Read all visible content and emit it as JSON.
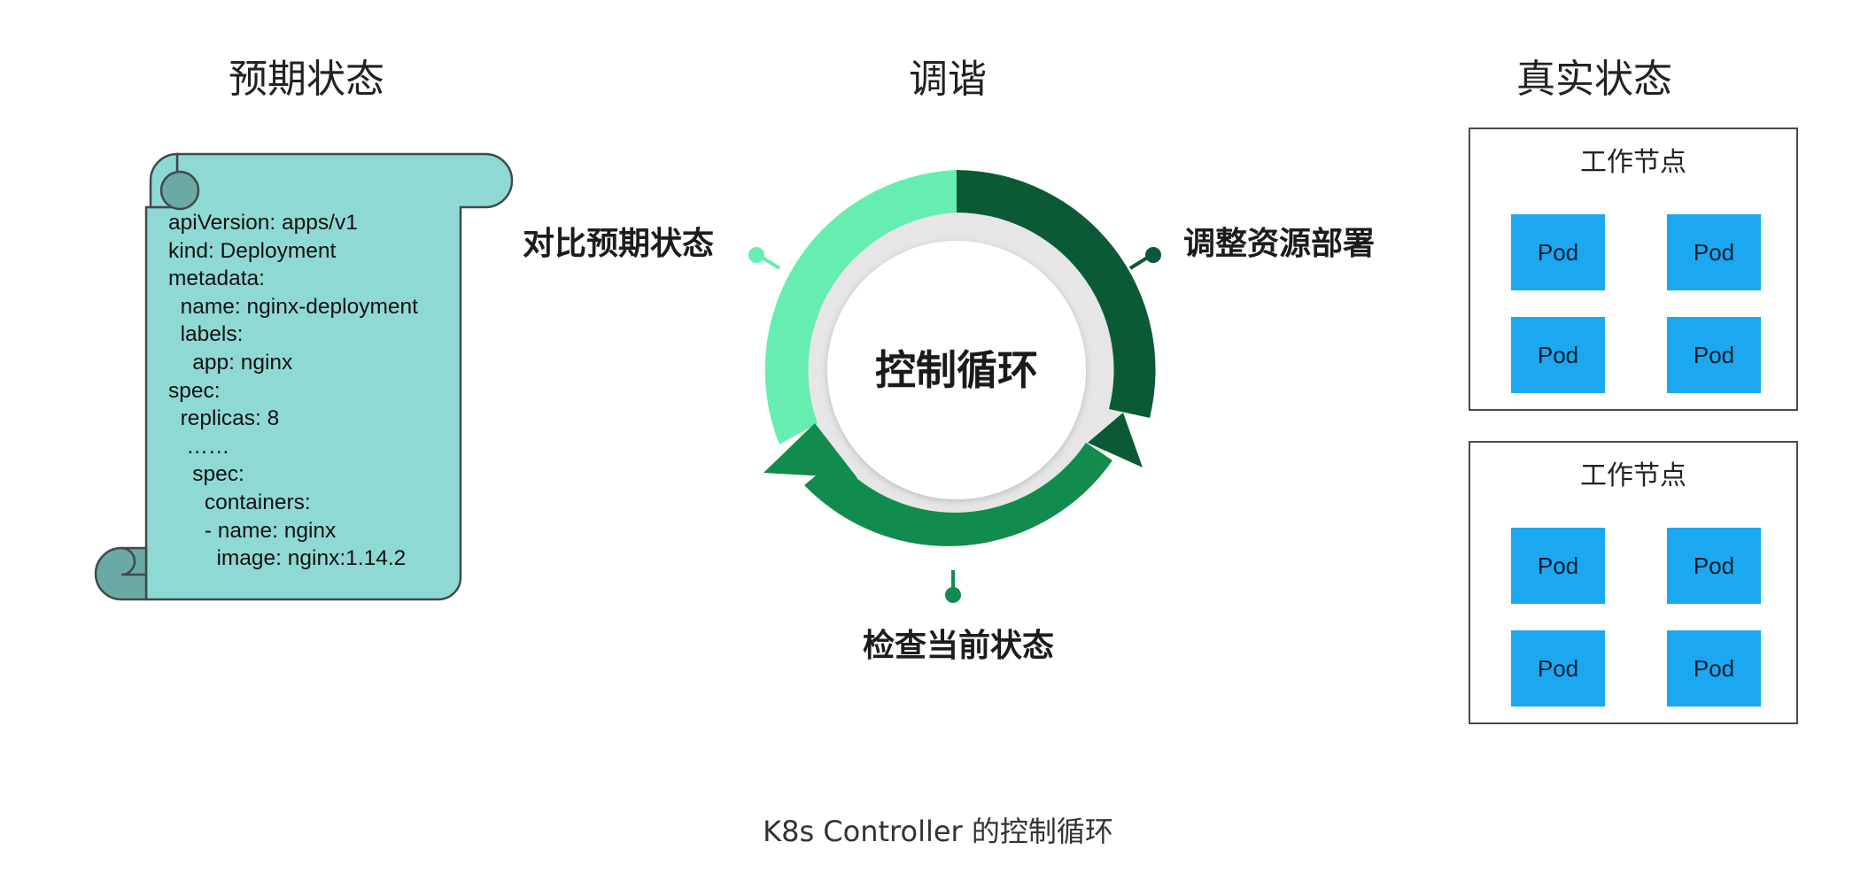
{
  "headings": {
    "desired_state": "预期状态",
    "reconcile": "调谐",
    "actual_state": "真实状态"
  },
  "manifest": {
    "lines": [
      "apiVersion: apps/v1",
      "kind: Deployment",
      "metadata:",
      "  name: nginx-deployment",
      "  labels:",
      "    app: nginx",
      "spec:",
      "  replicas: 8",
      "   ……",
      "    spec:",
      "      containers:",
      "      - name: nginx",
      "        image: nginx:1.14.2"
    ]
  },
  "loop": {
    "center": "控制循环",
    "compare": "对比预期状态",
    "adjust": "调整资源部署",
    "check": "检查当前状态"
  },
  "nodes": [
    {
      "title": "工作节点",
      "pods": [
        "Pod",
        "Pod",
        "Pod",
        "Pod"
      ]
    },
    {
      "title": "工作节点",
      "pods": [
        "Pod",
        "Pod",
        "Pod",
        "Pod"
      ]
    }
  ],
  "caption": "K8s Controller 的控制循环",
  "colors": {
    "scroll_fill": "#8fd9d4",
    "scroll_curl": "#6aa9a4",
    "loop_light": "#66eeb0",
    "loop_dark": "#0a5a36",
    "loop_mid": "#118c4e",
    "loop_inner": "#e6e6e6",
    "pod": "#1ba8f0"
  }
}
